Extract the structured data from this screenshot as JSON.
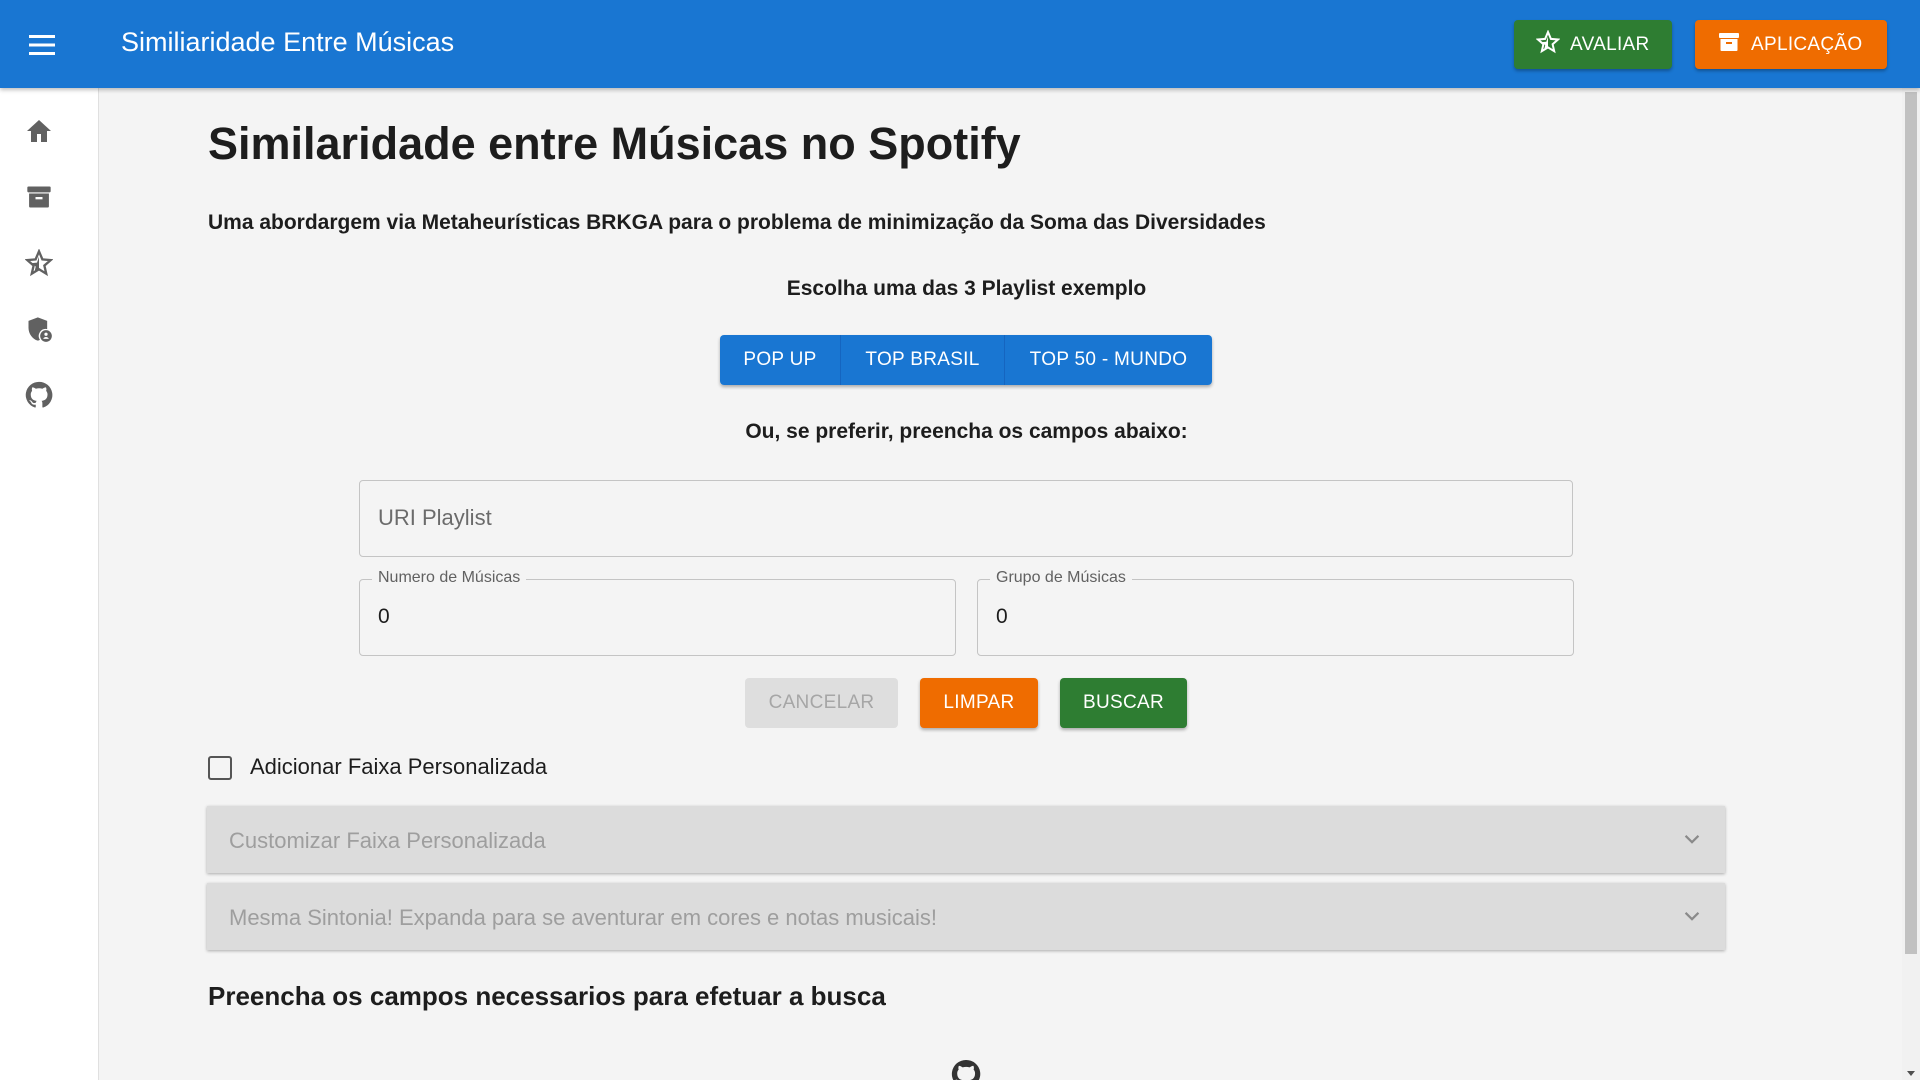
{
  "appbar": {
    "title": "Similiaridade Entre Músicas",
    "avaliar_label": "AVALIAR",
    "aplicacao_label": "APLICAÇÃO"
  },
  "sidebar": {
    "items": [
      {
        "icon": "home-icon"
      },
      {
        "icon": "archive-icon"
      },
      {
        "icon": "star-icon"
      },
      {
        "icon": "shield-person-icon"
      },
      {
        "icon": "github-icon"
      }
    ]
  },
  "main": {
    "title": "Similaridade entre Músicas no Spotify",
    "subtitle": "Uma abordargem via Metaheurísticas BRKGA para o problema de minimização da Soma das Diversidades",
    "choose_text": "Escolha uma das 3 Playlist exemplo",
    "playlists": [
      "POP UP",
      "TOP BRASIL",
      "TOP 50 - MUNDO"
    ],
    "or_text": "Ou, se preferir, preencha os campos abaixo:",
    "uri_placeholder": "URI Playlist",
    "num_label": "Numero de Músicas",
    "num_value": "0",
    "group_label": "Grupo de Músicas",
    "group_value": "0",
    "cancel_label": "CANCELAR",
    "limpar_label": "LIMPAR",
    "buscar_label": "BUSCAR",
    "checkbox_label": "Adicionar Faixa Personalizada",
    "accordion1": "Customizar Faixa Personalizada",
    "accordion2": "Mesma Sintonia! Expanda para se aventurar em cores e notas musicais!",
    "footer_text": "Preencha os campos necessarios para efetuar a busca"
  },
  "colors": {
    "primary": "#1976d2",
    "success": "#2e7d32",
    "warning": "#ef6c00"
  }
}
